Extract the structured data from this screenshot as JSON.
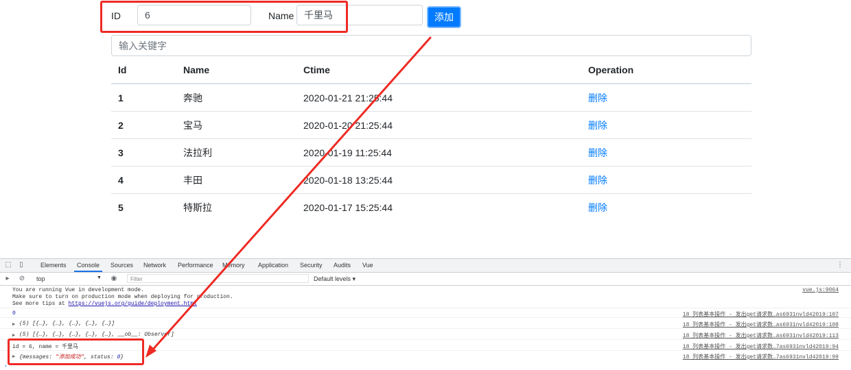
{
  "form": {
    "id_label": "ID",
    "id_value": "6",
    "name_label": "Name",
    "name_value": "千里马",
    "add_button": "添加"
  },
  "search": {
    "placeholder": "输入关键字"
  },
  "table": {
    "headers": [
      "Id",
      "Name",
      "Ctime",
      "Operation"
    ],
    "rows": [
      {
        "id": "1",
        "name": "奔驰",
        "ctime": "2020-01-21 21:25:44",
        "op": "删除"
      },
      {
        "id": "2",
        "name": "宝马",
        "ctime": "2020-01-20 21:25:44",
        "op": "删除"
      },
      {
        "id": "3",
        "name": "法拉利",
        "ctime": "2020-01-19 11:25:44",
        "op": "删除"
      },
      {
        "id": "4",
        "name": "丰田",
        "ctime": "2020-01-18 13:25:44",
        "op": "删除"
      },
      {
        "id": "5",
        "name": "特斯拉",
        "ctime": "2020-01-17 15:25:44",
        "op": "删除"
      }
    ]
  },
  "devtools": {
    "tabs": [
      "Elements",
      "Console",
      "Sources",
      "Network",
      "Performance",
      "Memory",
      "Application",
      "Security",
      "Audits",
      "Vue"
    ],
    "active_tab": "Console",
    "context": "top",
    "filter_placeholder": "Filter",
    "levels": "Default levels ▾",
    "console": {
      "l1": "You are running Vue in development mode.",
      "l2": "Make sure to turn on production mode when deploying for production.",
      "l3a": "See more tips at ",
      "l3b": "https://vuejs.org/guide/deployment.html",
      "l4": "0",
      "l5": "(5) [{…}, {…}, {…}, {…}, {…}]",
      "l6": "(5) [{…}, {…}, {…}, {…}, {…}, __ob__: Observer]",
      "l7": "id = 6, name = 千里马",
      "l8a": "{messages: ",
      "l8b": "\"添加成功\"",
      "l8c": ", status: ",
      "l8d": "0",
      "l8e": "}",
      "s1": "vue.js:9064",
      "s4": "18 列表基本操作 - 发出get请求数…as6931nvld42019:107",
      "s5": "18 列表基本操作 - 发出get请求数…as6931nvld42019:108",
      "s6": "18 列表基本操作 - 发出get请求数…as6931nvld42019:113",
      "s7": "18 列表基本操作 - 发出get请求数…7as6931nvld42019:94",
      "s8": "18 列表基本操作 - 发出get请求数…7as6931nvld42019:99"
    }
  },
  "colors": {
    "primary": "#007bff",
    "annotation_red": "#ee2a24"
  }
}
